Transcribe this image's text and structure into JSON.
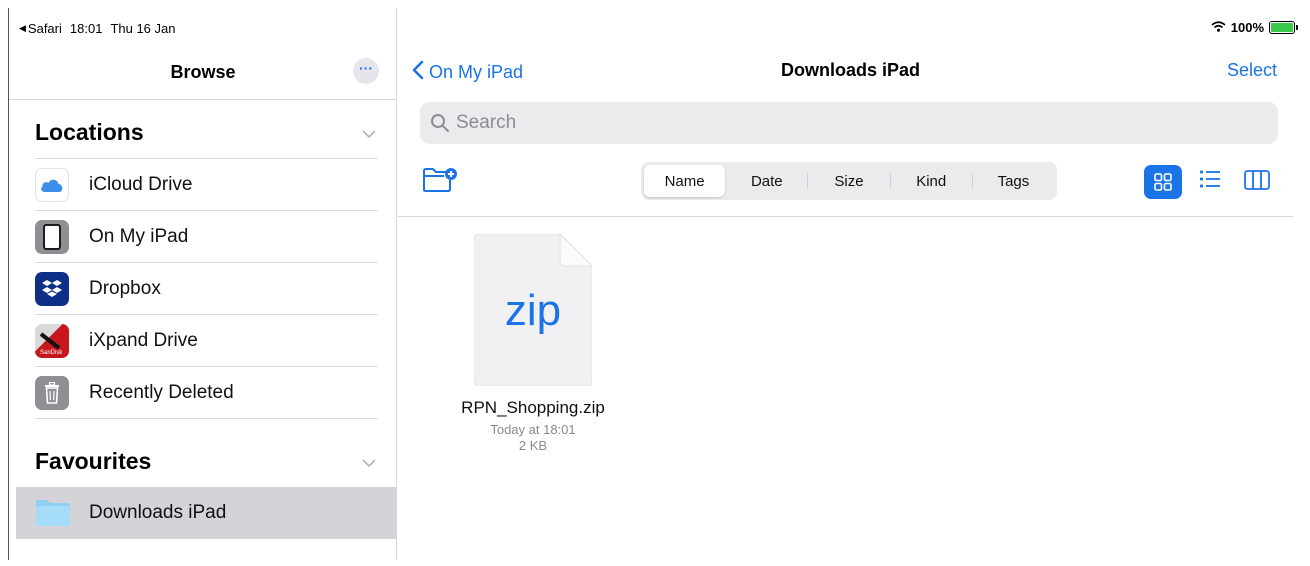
{
  "status_bar": {
    "back_app": "Safari",
    "time": "18:01",
    "date": "Thu 16 Jan",
    "battery": "100%"
  },
  "sidebar": {
    "title": "Browse",
    "more_label": "···",
    "locations": {
      "header": "Locations",
      "items": [
        {
          "label": "iCloud Drive",
          "icon": "icloud-icon"
        },
        {
          "label": "On My iPad",
          "icon": "ipad-icon"
        },
        {
          "label": "Dropbox",
          "icon": "dropbox-icon"
        },
        {
          "label": "iXpand Drive",
          "icon": "ixpand-icon"
        },
        {
          "label": "Recently Deleted",
          "icon": "trash-icon"
        }
      ]
    },
    "favourites": {
      "header": "Favourites",
      "items": [
        {
          "label": "Downloads iPad",
          "icon": "folder-icon",
          "selected": true
        }
      ]
    }
  },
  "main": {
    "back_label": "On My iPad",
    "title": "Downloads iPad",
    "select_label": "Select",
    "search_placeholder": "Search",
    "sort_options": [
      "Name",
      "Date",
      "Size",
      "Kind",
      "Tags"
    ],
    "sort_selected": "Name",
    "view_mode": "grid",
    "files": [
      {
        "name": "RPN_Shopping.zip",
        "ext": "zip",
        "modified": "Today at 18:01",
        "size": "2 KB"
      }
    ]
  },
  "colors": {
    "accent": "#1a74e8",
    "selected_row": "#d3d3d8",
    "search_bg": "#ebebee"
  }
}
